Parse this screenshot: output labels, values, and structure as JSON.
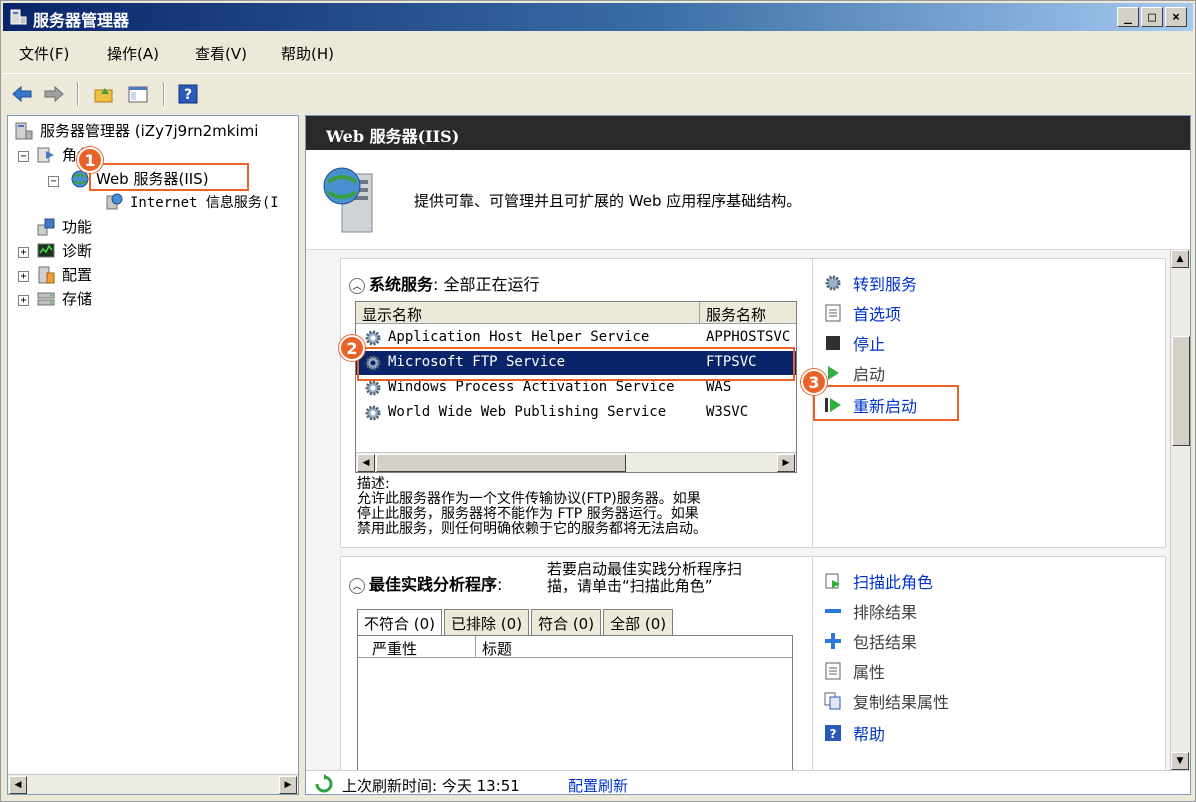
{
  "window": {
    "title": "服务器管理器",
    "controls": [
      "_",
      "□",
      "×"
    ]
  },
  "menu": [
    "文件(F)",
    "操作(A)",
    "查看(V)",
    "帮助(H)"
  ],
  "tree": {
    "root": "服务器管理器 (iZy7j9rn2mkimi",
    "roles": "角色",
    "web": "Web 服务器(IIS)",
    "iis": "Internet 信息服务(I",
    "features": "功能",
    "diagnostics": "诊断",
    "config": "配置",
    "storage": "存储",
    "expanders": {
      "roles": "−",
      "web": "−",
      "diagnostics": "+",
      "config": "+",
      "storage": "+"
    }
  },
  "right": {
    "header": "Web 服务器(IIS)",
    "intro": "提供可靠、可管理并且可扩展的 Web 应用程序基础结构。"
  },
  "system_services": {
    "title": "系统服务",
    "status": ": 全部正在运行",
    "columns": [
      "显示名称",
      "服务名称"
    ],
    "rows": [
      {
        "name": "Application Host Helper Service",
        "code": "APPHOSTSVC"
      },
      {
        "name": "Microsoft FTP Service",
        "code": "FTPSVC"
      },
      {
        "name": "Windows Process Activation Service",
        "code": "WAS"
      },
      {
        "name": "World Wide Web Publishing Service",
        "code": "W3SVC"
      }
    ],
    "description_label": "描述:",
    "description_lines": [
      "允许此服务器作为一个文件传输协议(FTP)服务器。如果",
      "停止此服务，服务器将不能作为 FTP 服务器运行。如果",
      "禁用此服务，则任何明确依赖于它的服务都将无法启动。"
    ],
    "actions": {
      "goto": "转到服务",
      "prefs": "首选项",
      "stop": "停止",
      "start": "启动",
      "restart": "重新启动"
    }
  },
  "bpa": {
    "title": "最佳实践分析程序",
    "colon": ":",
    "hint_lines": [
      "若要启动最佳实践分析程序扫",
      "描，请单击“扫描此角色”"
    ],
    "tabs": [
      "不符合 (0)",
      "已排除 (0)",
      "符合 (0)",
      "全部 (0)"
    ],
    "columns": [
      "严重性",
      "标题"
    ],
    "actions": {
      "scan": "扫描此角色",
      "exclude": "排除结果",
      "include": "包括结果",
      "properties": "属性",
      "copy": "复制结果属性",
      "help": "帮助"
    }
  },
  "status": {
    "label": "上次刷新时间: 今天 13:51",
    "link": "配置刷新"
  },
  "callouts": [
    "1",
    "2",
    "3"
  ],
  "colors": {
    "accent": "#e8622a",
    "selection": "#0a246a",
    "link": "#0033cc",
    "header": "#2a2a2a"
  }
}
